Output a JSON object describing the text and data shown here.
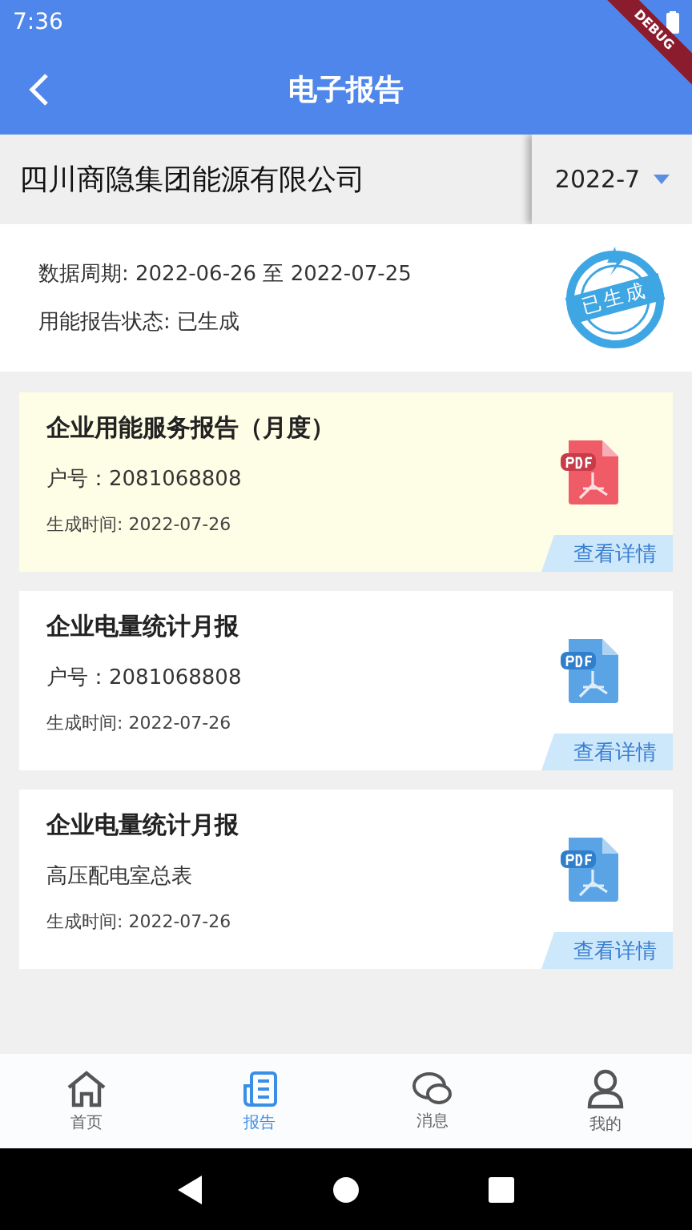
{
  "status_bar": {
    "time": "7:36"
  },
  "debug_banner": "DEBUG",
  "app_bar": {
    "title": "电子报告"
  },
  "company": {
    "name": "四川商隐集团能源有限公司",
    "period_select": "2022-7"
  },
  "summary": {
    "period": "数据周期: 2022-06-26 至 2022-07-25",
    "status": "用能报告状态: 已生成",
    "stamp": "已生成"
  },
  "reports": [
    {
      "title": "企业用能服务报告（月度）",
      "detail": "户号：2081068808",
      "time": "生成时间: 2022-07-26",
      "action": "查看详情",
      "selected": true
    },
    {
      "title": "企业电量统计月报",
      "detail": "户号：2081068808",
      "time": "生成时间: 2022-07-26",
      "action": "查看详情",
      "selected": false
    },
    {
      "title": "企业电量统计月报",
      "detail": "高压配电室总表",
      "time": "生成时间: 2022-07-26",
      "action": "查看详情",
      "selected": false
    }
  ],
  "bottom_nav": [
    {
      "kind": "home",
      "label": "首页",
      "selected": false
    },
    {
      "kind": "report",
      "label": "报告",
      "selected": true
    },
    {
      "kind": "message",
      "label": "消息",
      "selected": false
    },
    {
      "kind": "profile",
      "label": "我的",
      "selected": false
    }
  ]
}
